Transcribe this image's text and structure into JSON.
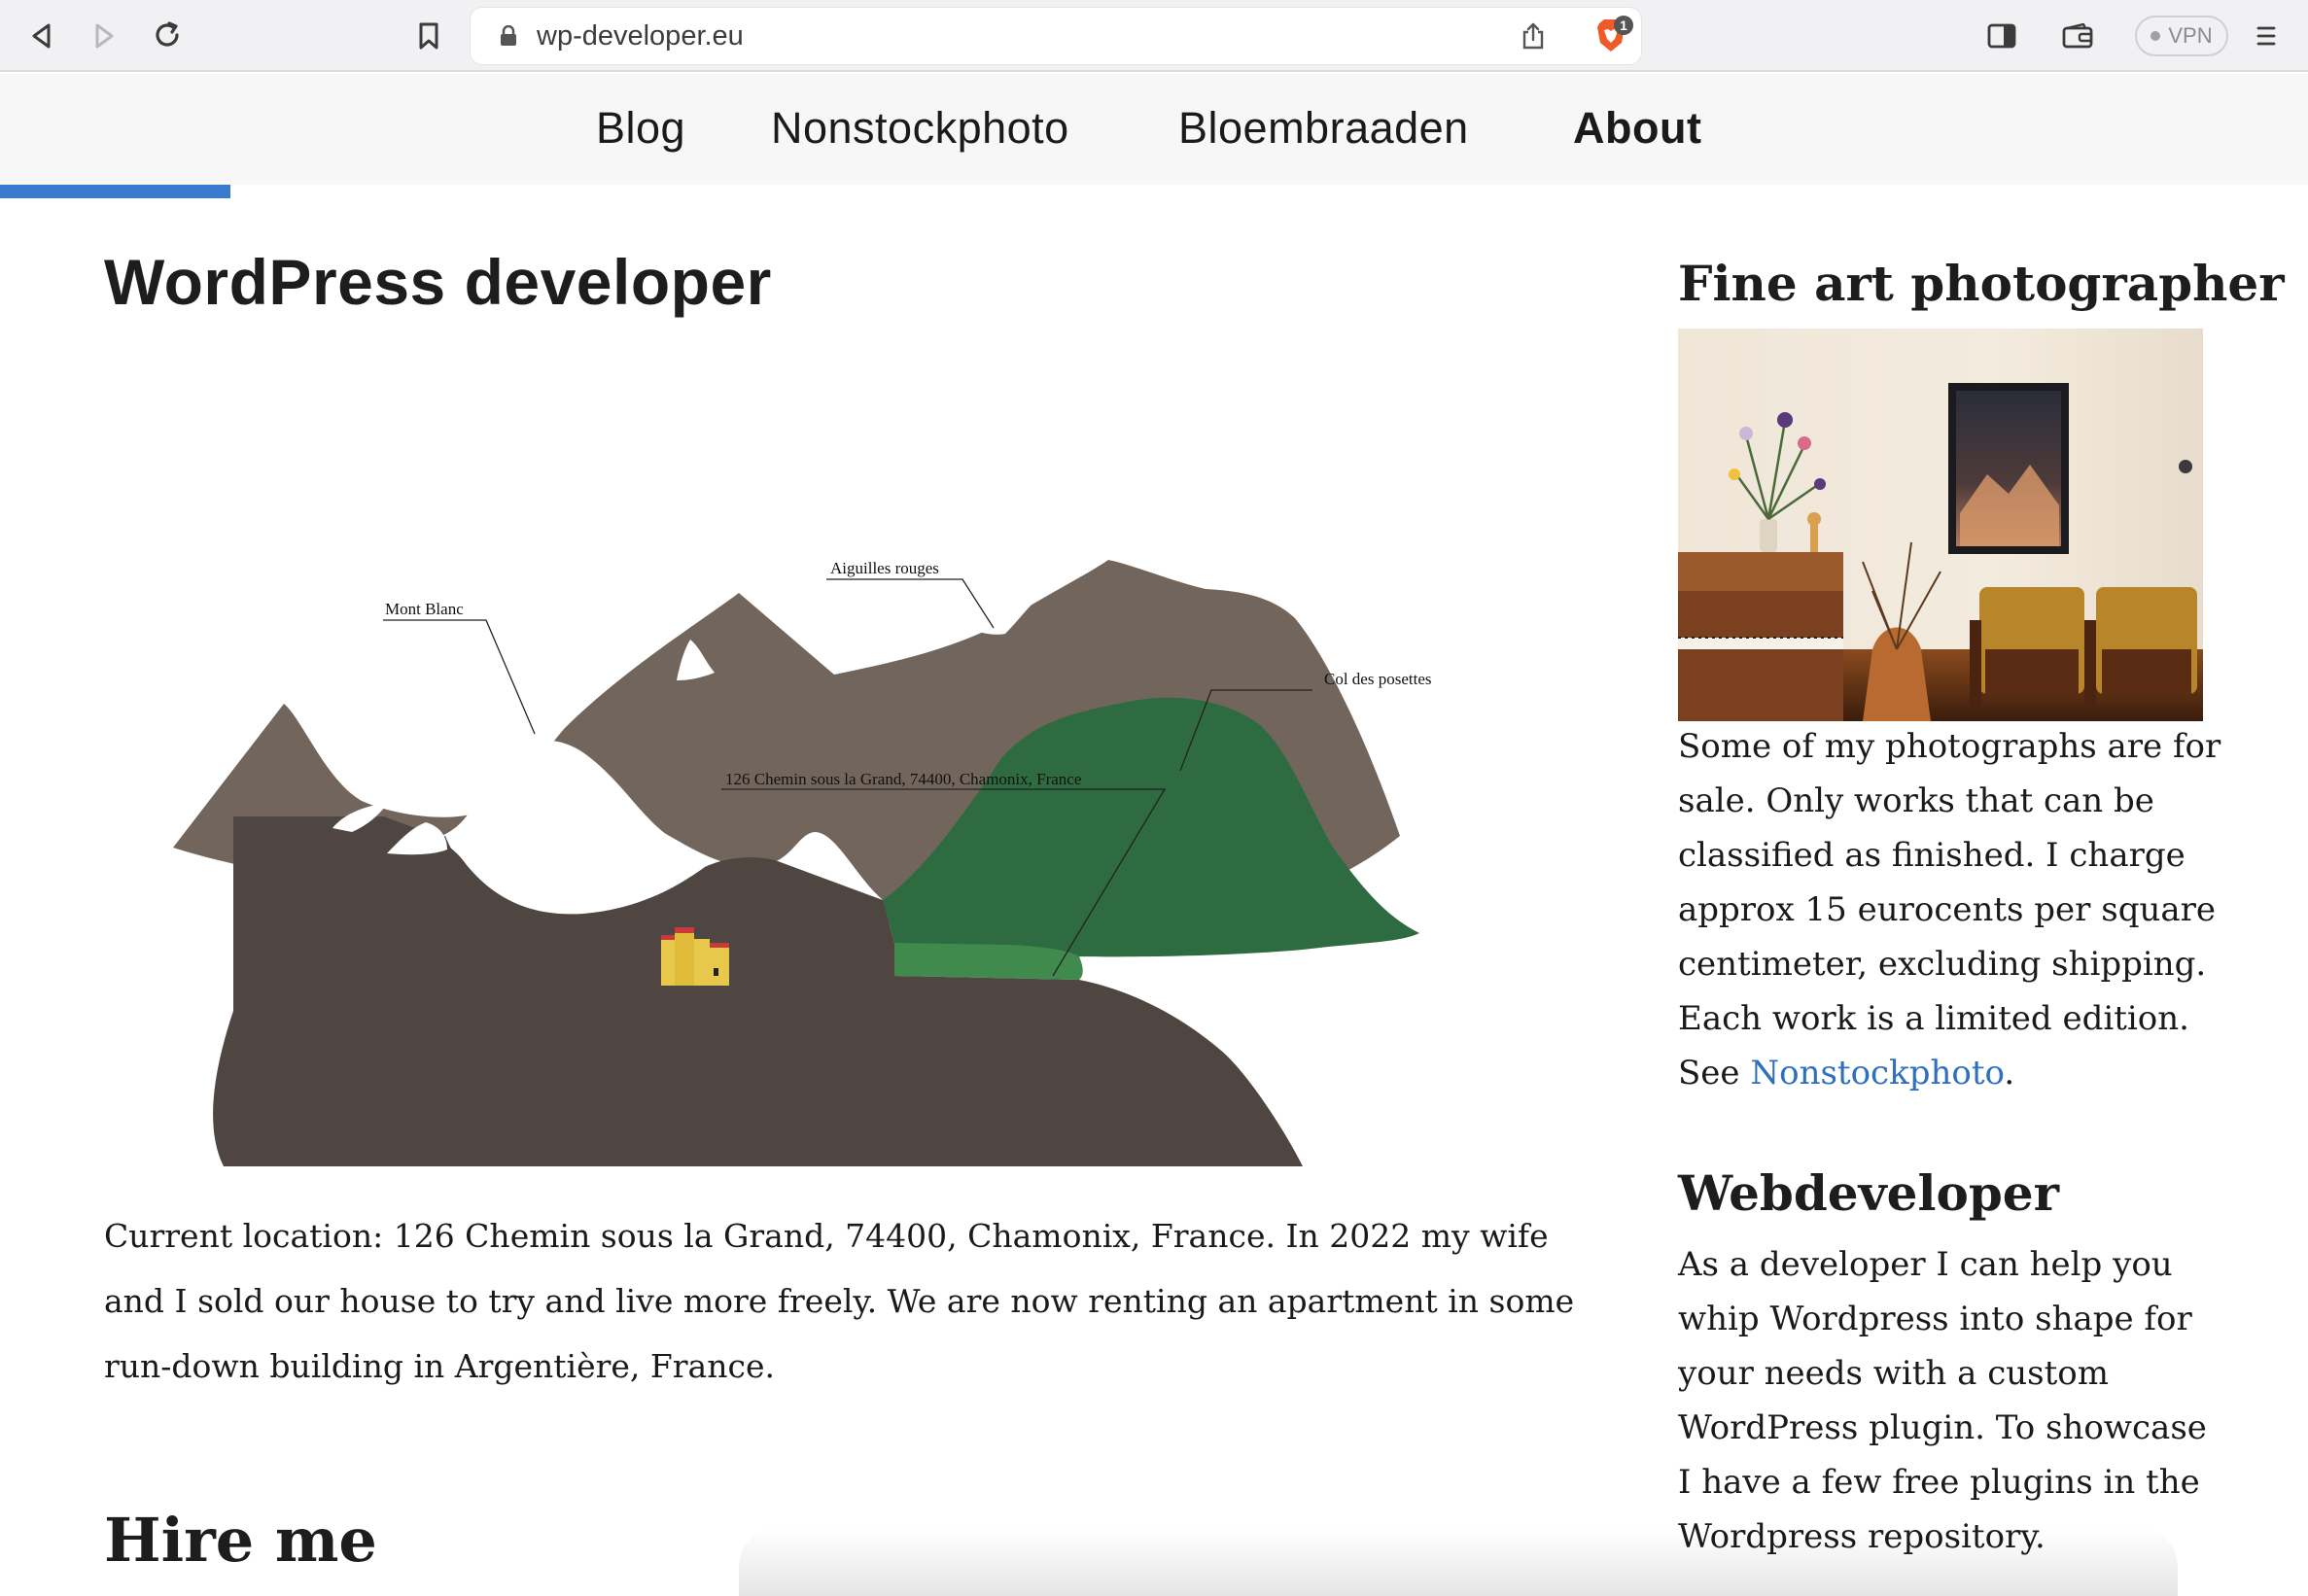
{
  "browser": {
    "url": "wp-developer.eu",
    "shield_badge": "1",
    "vpn_label": "VPN",
    "icons": [
      "back-icon",
      "forward-icon",
      "reload-icon",
      "bookmark-icon",
      "lock-icon",
      "share-icon",
      "brave-shield-icon",
      "sidebar-icon",
      "wallet-icon",
      "menu-icon"
    ]
  },
  "nav": {
    "items": [
      {
        "label": "Blog",
        "active": false
      },
      {
        "label": "Nonstockphoto",
        "active": false
      },
      {
        "label": "Bloembraaden",
        "active": false
      },
      {
        "label": "About",
        "active": true
      }
    ],
    "scroll_progress": 0.1,
    "accent": "#3a7bd0"
  },
  "main": {
    "title": "WordPress developer",
    "map_labels": {
      "mont_blanc": "Mont Blanc",
      "aiguilles": "Aiguilles rouges",
      "col": "Col des posettes",
      "address": "126 Chemin sous la Grand, 74400, Chamonix, France"
    },
    "paragraph": "Current location: 126 Chemin sous la Grand, 74400, Chamonix, France. In 2022 my wife and I sold our house to try and live more freely. We are now renting an apartment in some run-down building in Argentière, France.",
    "hire_heading": "Hire me"
  },
  "sidebar": {
    "photographer_heading": "Fine art photographer",
    "photographer_text": "Some of my photographs are for sale. Only works that can be classified as finished. I charge approx 15 eurocents per square centimeter, excluding shipping. Each work is a limited edition. See",
    "photographer_link": "Nonstockphoto",
    "photographer_suffix": ".",
    "webdev_heading": "Webdeveloper",
    "webdev_text": "As a developer I can help you whip Wordpress into shape for your needs with a custom WordPress plugin. To showcase I have a few free plugins in the Wordpress repository."
  }
}
